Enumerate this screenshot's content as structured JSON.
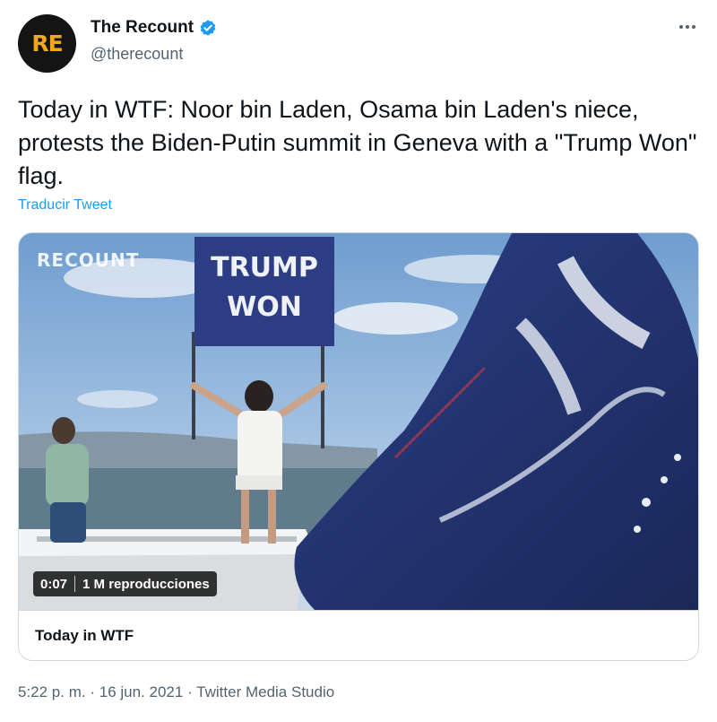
{
  "author": {
    "avatar_text": "RE",
    "name": "The Recount",
    "handle": "@therecount",
    "verified": true
  },
  "tweet": {
    "text": "Today in WTF: Noor bin Laden, Osama bin Laden's niece, protests the Biden-Putin summit in Geneva with a \"Trump Won\" flag.",
    "translate_label": "Traducir Tweet"
  },
  "media": {
    "watermark": "RECOUNT",
    "flag_text_line1": "TRUMP",
    "flag_text_line2": "WON",
    "duration": "0:07",
    "views": "1 M reproducciones",
    "card_title": "Today in WTF"
  },
  "meta": {
    "time": "5:22 p. m.",
    "date": "16 jun. 2021",
    "separator": "·",
    "source": "Twitter Media Studio"
  },
  "colors": {
    "accent": "#1d9bf0",
    "logo": "#f0a81f",
    "secondary_text": "#536471"
  },
  "icons": {
    "verified": "verified-badge-icon",
    "more": "more-dots-icon",
    "play": "video-player"
  }
}
